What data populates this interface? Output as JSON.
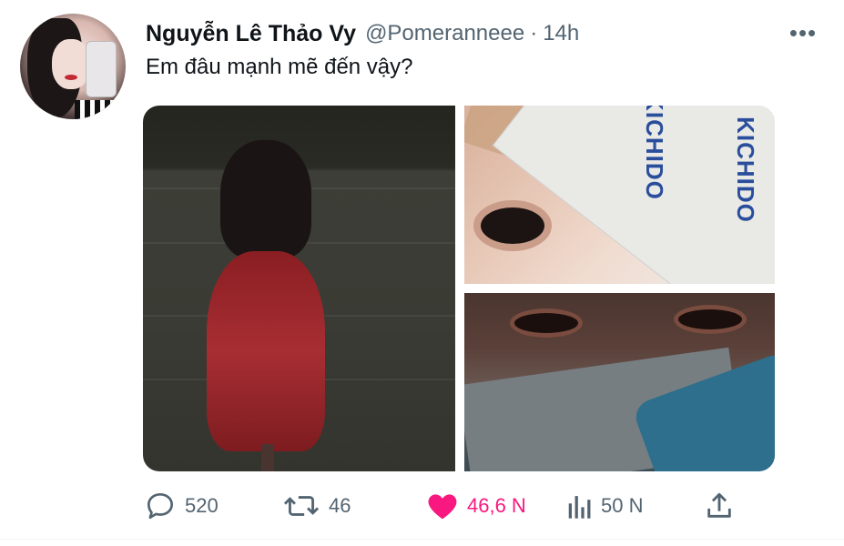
{
  "tweet": {
    "author_name": "Nguyễn Lê Thảo Vy",
    "author_handle": "@Pomeranneee",
    "separator": "·",
    "time": "14h",
    "more_icon": "•••",
    "text": "Em đâu mạnh mẽ đến vậy?",
    "media": {
      "brand_text": "KICHIDO"
    }
  },
  "actions": {
    "reply_count": "520",
    "retweet_count": "46",
    "like_count": "46,6 N",
    "views_count": "50 N",
    "liked": true
  },
  "colors": {
    "text_primary": "#0f1419",
    "text_secondary": "#536471",
    "like_pink": "#f91880"
  },
  "icons": [
    "reply-icon",
    "retweet-icon",
    "heart-icon",
    "views-icon",
    "share-icon",
    "more-icon"
  ]
}
